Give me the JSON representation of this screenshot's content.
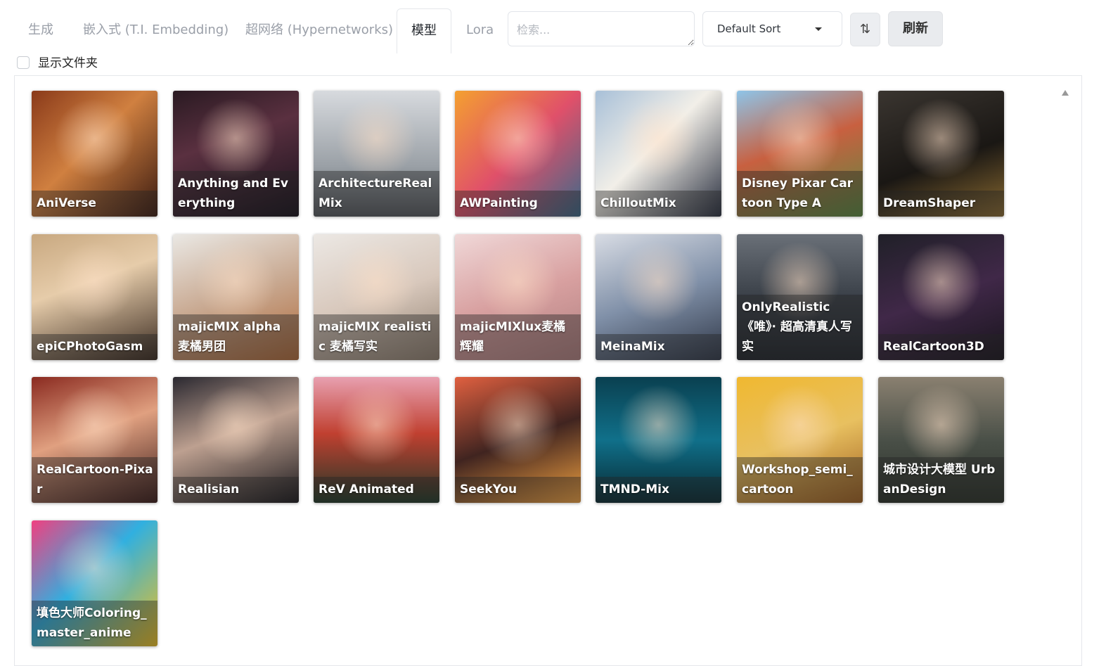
{
  "tabs": [
    {
      "label": "生成"
    },
    {
      "label": "嵌入式 (T.I. Embedding)"
    },
    {
      "label": "超网络 (Hypernetworks)"
    },
    {
      "label": "模型",
      "active": true
    },
    {
      "label": "Lora"
    }
  ],
  "search": {
    "placeholder": "检索...",
    "value": ""
  },
  "sort": {
    "selected": "Default Sort"
  },
  "sort_direction_icon": "⇅",
  "refresh_label": "刷新",
  "show_folders_label": "显示文件夹",
  "models": [
    {
      "name": "AniVerse",
      "icon": "anime-portrait",
      "bg": "linear-gradient(135deg,#8a3a1a,#d08040 45%,#3a1a10)"
    },
    {
      "name": "Anything and Everything",
      "icon": "dark-figure",
      "bg": "linear-gradient(160deg,#2a1a22,#5a3040 40%,#15101a)"
    },
    {
      "name": "ArchitectureRealMix",
      "icon": "skyscraper",
      "bg": "linear-gradient(180deg,#d7dade,#9aa0a6 60%,#55595e)"
    },
    {
      "name": "AWPainting",
      "icon": "anime-portrait",
      "bg": "linear-gradient(135deg,#f4a030,#e0506a 50%,#3a6a8a)"
    },
    {
      "name": "ChilloutMix",
      "icon": "photo-portrait",
      "bg": "linear-gradient(135deg,#a8c0d8,#f2efe8 45%,#2a3040)"
    },
    {
      "name": "Disney Pixar Cartoon Type A",
      "icon": "cartoon-portrait",
      "bg": "linear-gradient(160deg,#8ec4e8,#c86040 45%,#5a8a40)"
    },
    {
      "name": "DreamShaper",
      "icon": "fantasy-portrait",
      "bg": "linear-gradient(160deg,#3a3530,#1a1714 55%,#8a6a30)"
    },
    {
      "name": "epiCPhotoGasm",
      "icon": "photo-portrait",
      "bg": "linear-gradient(160deg,#c8a880,#e6ccaa 40%,#3a2a20)"
    },
    {
      "name": "majicMIX alpha 麦橘男团",
      "icon": "photo-portrait",
      "bg": "linear-gradient(160deg,#eae8e4,#c8a890 50%,#b06a3a)"
    },
    {
      "name": "majicMIX realistic 麦橘写实",
      "icon": "photo-portrait",
      "bg": "linear-gradient(160deg,#ece8e4,#d8c8bc 50%,#908070)"
    },
    {
      "name": "majicMIXlux麦橘辉耀",
      "icon": "photo-portrait",
      "bg": "linear-gradient(160deg,#f0d8d8,#d8a0a0 50%,#b08080)"
    },
    {
      "name": "MeinaMix",
      "icon": "anime-portrait",
      "bg": "linear-gradient(160deg,#d8dce4,#8090a8 50%,#303848)"
    },
    {
      "name": "OnlyRealistic 《唯》· 超高清真人写实",
      "icon": "landscape",
      "bg": "linear-gradient(180deg,#6a7078,#3a4048 50%,#20242a)"
    },
    {
      "name": "RealCartoon3D",
      "icon": "cartoon-portrait",
      "bg": "linear-gradient(160deg,#202028,#402848 50%,#18141c)"
    },
    {
      "name": "RealCartoon-Pixar",
      "icon": "cartoon-portrait",
      "bg": "linear-gradient(160deg,#8a2a20,#e0a080 45%,#3a1a18)"
    },
    {
      "name": "Realisian",
      "icon": "photo-portrait",
      "bg": "linear-gradient(160deg,#2a2830,#bda090 45%,#1a181c)"
    },
    {
      "name": "ReV Animated",
      "icon": "torii-gate",
      "bg": "linear-gradient(180deg,#e8a0b0,#c04030 45%,#203828)"
    },
    {
      "name": "SeekYou",
      "icon": "anime-portrait",
      "bg": "linear-gradient(160deg,#e06040,#402420 50%,#f0a040)"
    },
    {
      "name": "TMND-Mix",
      "icon": "underwater",
      "bg": "linear-gradient(180deg,#0a4050,#10708a 50%,#082830)"
    },
    {
      "name": "Workshop_semi_cartoon",
      "icon": "cartoon-portrait",
      "bg": "linear-gradient(160deg,#f0b830,#e8c060 50%,#a06020)"
    },
    {
      "name": "城市设计大模型 UrbanDesign",
      "icon": "aerial-city",
      "bg": "linear-gradient(180deg,#8a8070,#4a5048 50%,#2a3028)"
    },
    {
      "name": "填色大师Coloring_master_anime",
      "icon": "anime-portrait",
      "bg": "linear-gradient(135deg,#f04080,#30b0e0 45%,#f0c020)"
    }
  ]
}
